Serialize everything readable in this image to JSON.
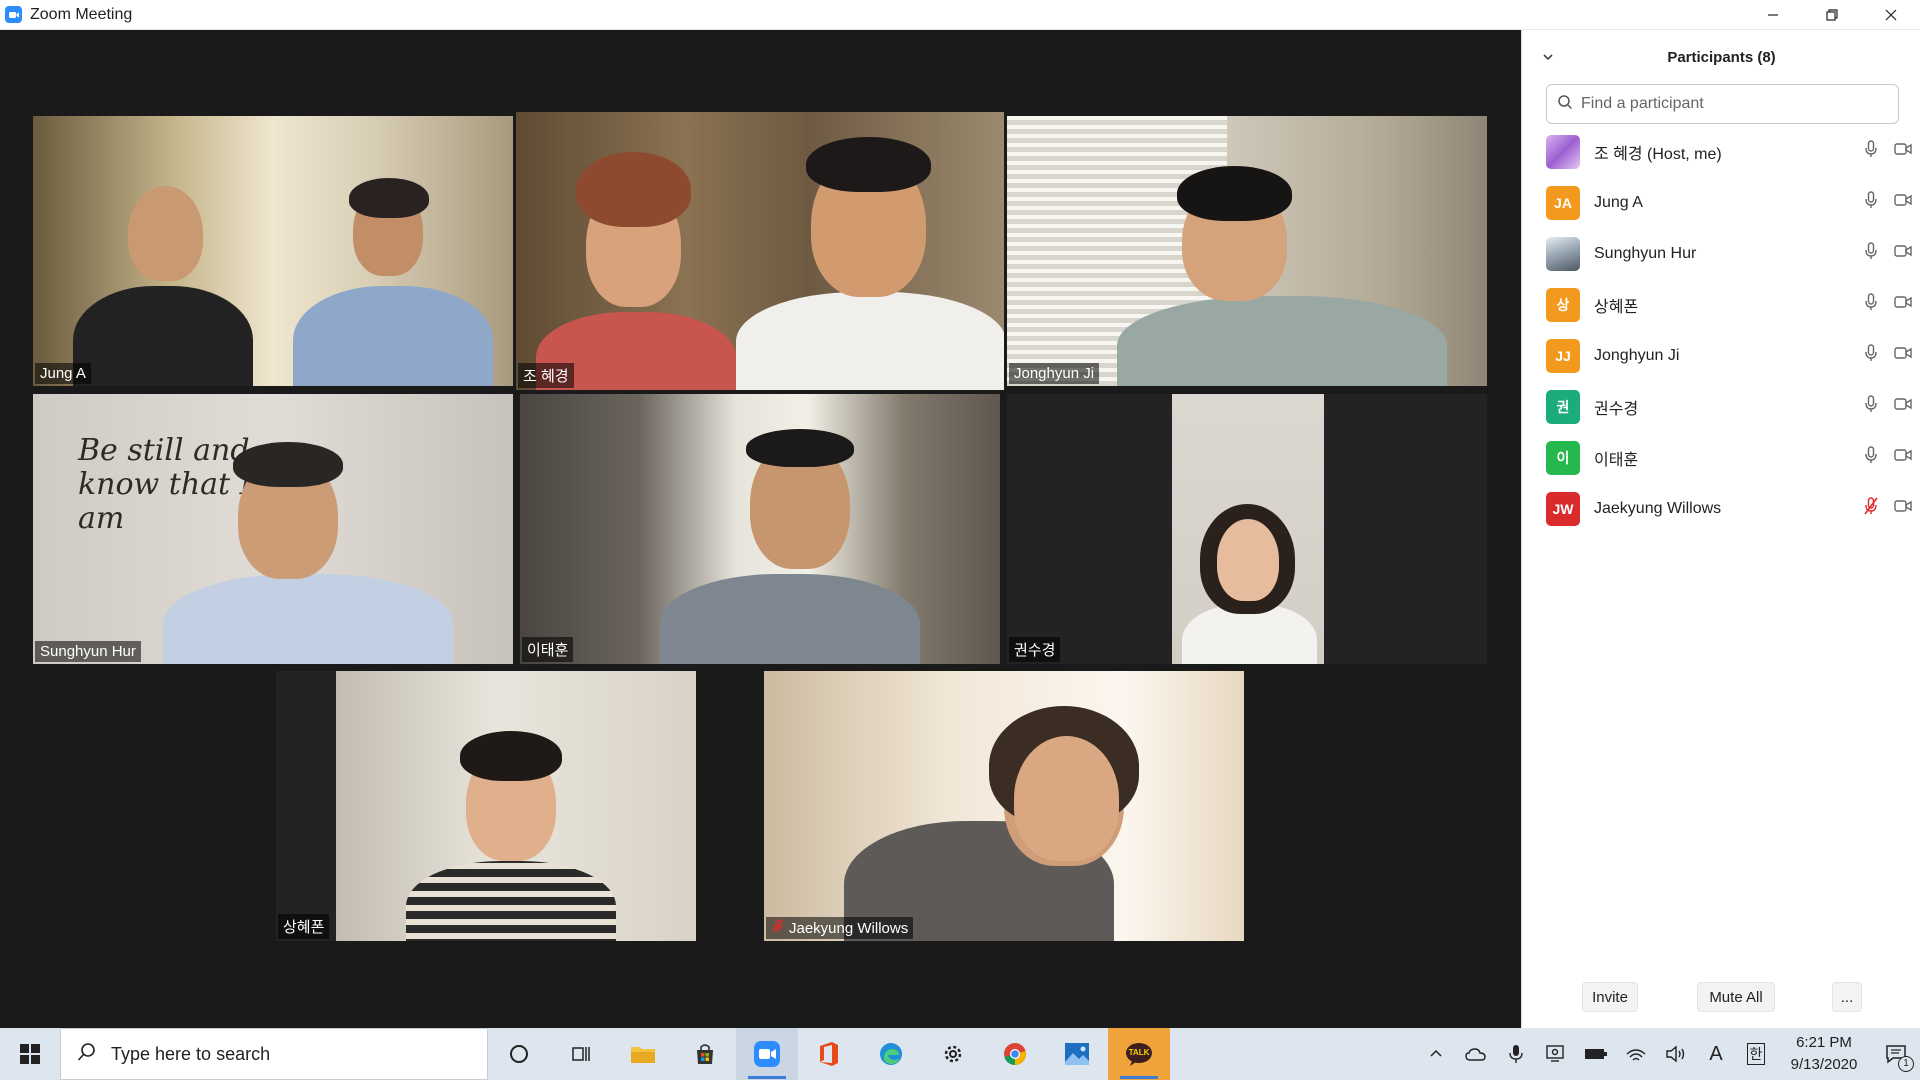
{
  "window": {
    "title": "Zoom Meeting",
    "controls": [
      "minimize",
      "restore",
      "close"
    ]
  },
  "gallery": {
    "tiles": [
      {
        "name": "Jung A",
        "muted": false,
        "active": false
      },
      {
        "name": "조 혜경",
        "muted": false,
        "active": true
      },
      {
        "name": "Jonghyun Ji",
        "muted": false,
        "active": false
      },
      {
        "name": "Sunghyun Hur",
        "muted": false,
        "active": false
      },
      {
        "name": "이태훈",
        "muted": false,
        "active": false
      },
      {
        "name": "권수경",
        "muted": false,
        "active": false
      },
      {
        "name": "상혜폰",
        "muted": false,
        "active": false
      },
      {
        "name": "Jaekyung Willows",
        "muted": true,
        "active": false
      }
    ],
    "wall_text": "Be still and know that I am"
  },
  "participants": {
    "title": "Participants (8)",
    "search_placeholder": "Find a participant",
    "list": [
      {
        "name": "조 혜경 (Host, me)",
        "initials": "",
        "avatar_color": "#b583e0",
        "mic_muted": false
      },
      {
        "name": "Jung A",
        "initials": "JA",
        "avatar_color": "#f39a1e",
        "mic_muted": false
      },
      {
        "name": "Sunghyun Hur",
        "initials": "",
        "avatar_color": "#8a9aa8",
        "mic_muted": false
      },
      {
        "name": "상혜폰",
        "initials": "상",
        "avatar_color": "#f39a1e",
        "mic_muted": false
      },
      {
        "name": "Jonghyun Ji",
        "initials": "JJ",
        "avatar_color": "#f39a1e",
        "mic_muted": false
      },
      {
        "name": "권수경",
        "initials": "권",
        "avatar_color": "#1bab7c",
        "mic_muted": false
      },
      {
        "name": "이태훈",
        "initials": "이",
        "avatar_color": "#25b84f",
        "mic_muted": false
      },
      {
        "name": "Jaekyung Willows",
        "initials": "JW",
        "avatar_color": "#d92b2b",
        "mic_muted": true
      }
    ],
    "footer": {
      "invite": "Invite",
      "mute_all": "Mute All",
      "more": "..."
    }
  },
  "taskbar": {
    "search_placeholder": "Type here to search",
    "time": "6:21 PM",
    "date": "9/13/2020",
    "ime_label": "A",
    "ime_korean": "한",
    "notification_count": "1",
    "kakao_label": "TALK"
  },
  "colors": {
    "zoom_blue": "#2d8cff",
    "active_speaker_border": "#e9ec83",
    "muted_red": "#e02828"
  }
}
